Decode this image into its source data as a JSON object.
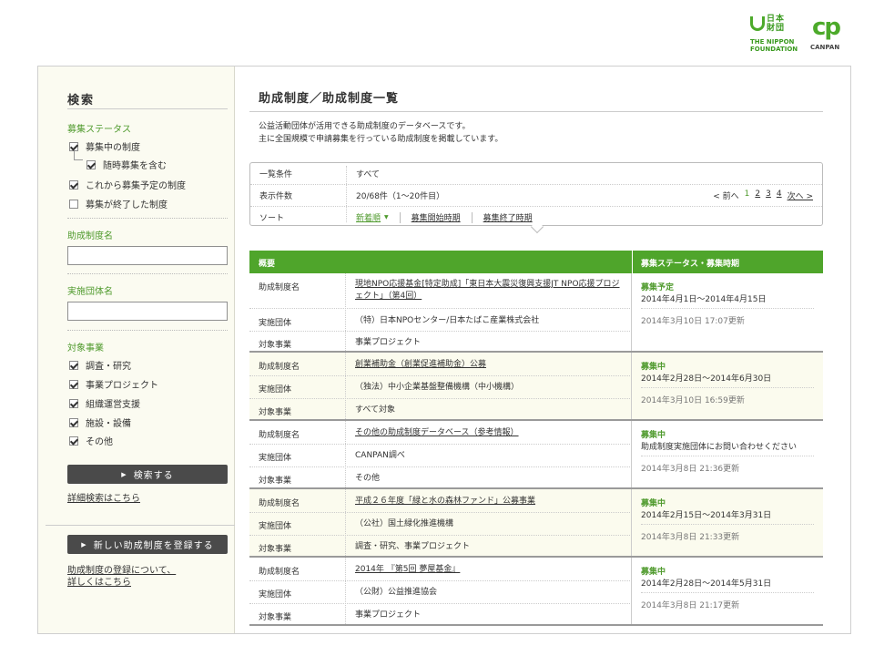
{
  "logos": {
    "nippon_kanji": "日本 財団",
    "nippon_text_1": "THE NIPPON",
    "nippon_text_2": "FOUNDATION",
    "canpan_mark": "cp",
    "canpan_text": "CANPAN"
  },
  "sidebar": {
    "title": "検索",
    "status_heading": "募集ステータス",
    "status_options": [
      {
        "label": "募集中の制度",
        "checked": true
      },
      {
        "label": "随時募集を含む",
        "checked": true
      },
      {
        "label": "これから募集予定の制度",
        "checked": true
      },
      {
        "label": "募集が終了した制度",
        "checked": false
      }
    ],
    "grant_name_heading": "助成制度名",
    "grant_name_value": "",
    "org_heading": "実施団体名",
    "org_value": "",
    "target_heading": "対象事業",
    "target_options": [
      {
        "label": "調査・研究",
        "checked": true
      },
      {
        "label": "事業プロジェクト",
        "checked": true
      },
      {
        "label": "組織運営支援",
        "checked": true
      },
      {
        "label": "施設・設備",
        "checked": true
      },
      {
        "label": "その他",
        "checked": true
      }
    ],
    "search_button": "検索する",
    "advanced_link": "詳細検索はこちら",
    "register_button": "新しい助成制度を登録する",
    "register_note_1": "助成制度の登録について、",
    "register_note_2": "詳しくはこちら"
  },
  "main": {
    "title": "助成制度／助成制度一覧",
    "desc_1": "公益活動団体が活用できる助成制度のデータベースです。",
    "desc_2": "主に全国規模で申請募集を行っている助成制度を掲載しています。",
    "conditions": {
      "filter_label": "一覧条件",
      "filter_value": "すべて",
      "count_label": "表示件数",
      "count_value": "20/68件（1〜20件目）",
      "pager": {
        "prev": "< 前へ",
        "pages": [
          "1",
          "2",
          "3",
          "4"
        ],
        "current": "1",
        "next": "次へ >"
      },
      "sort_label": "ソート",
      "sort_active": "新着順",
      "sort_options": [
        "募集開始時期",
        "募集終了時期"
      ]
    },
    "table": {
      "col_overview": "概要",
      "col_status": "募集ステータス・募集時期",
      "field_name": "助成制度名",
      "field_org": "実施団体",
      "field_target": "対象事業",
      "records": [
        {
          "name": "現地NPO応援基金[特定助成]「東日本大震災復興支援JT NPO応援プロジェクト」（第4回）",
          "org": "（特）日本NPOセンター/日本たばこ産業株式会社",
          "target": "事業プロジェクト",
          "status": "募集予定",
          "period": "2014年4月1日〜2014年4月15日",
          "updated": "2014年3月10日 17:07更新"
        },
        {
          "name": "創業補助金（創業促進補助金）公募",
          "org": "（独法）中小企業基盤整備機構（中小機構）",
          "target": "すべて対象",
          "status": "募集中",
          "period": "2014年2月28日〜2014年6月30日",
          "updated": "2014年3月10日 16:59更新"
        },
        {
          "name": "その他の助成制度データベース（参考情報）",
          "org": "CANPAN調べ",
          "target": "その他",
          "status": "募集中",
          "period": "助成制度実施団体にお問い合わせください",
          "updated": "2014年3月8日 21:36更新"
        },
        {
          "name": "平成２６年度「緑と水の森林ファンド」公募事業",
          "org": "（公社）国土緑化推進機構",
          "target": "調査・研究、事業プロジェクト",
          "status": "募集中",
          "period": "2014年2月15日〜2014年3月31日",
          "updated": "2014年3月8日 21:33更新"
        },
        {
          "name": "2014年 『第5回 夢屋基金』",
          "org": "（公財）公益推進協会",
          "target": "事業プロジェクト",
          "status": "募集中",
          "period": "2014年2月28日〜2014年5月31日",
          "updated": "2014年3月8日 21:17更新"
        }
      ]
    }
  }
}
